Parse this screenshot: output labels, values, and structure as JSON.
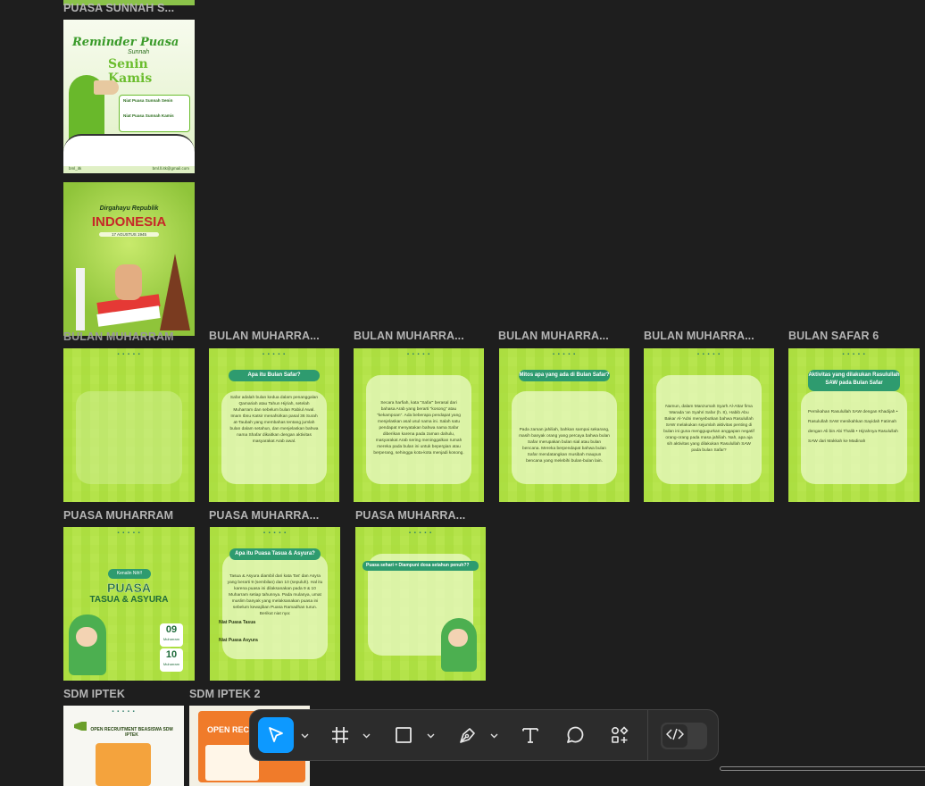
{
  "frames": {
    "top_label": "PUASA SUNNAH S...",
    "reminder": {
      "title_line1": "Reminder Puasa",
      "title_line2": "Sunnah",
      "title_line3": "Senin Kamis",
      "niat1": "Niat Puasa Sunnah Senin",
      "niat2": "Niat Puasa Sunnah Kamis",
      "footer_handle": "bml_itk",
      "footer_email": "bml.ll.itk@gmail.com"
    },
    "dirgahayu": {
      "line1": "Dirgahayu Republik",
      "line2": "INDONESIA",
      "line3": "17 AGUSTUS 1945"
    },
    "row1_labels": [
      "BULAN MUHARRAM",
      "BULAN MUHARRA...",
      "BULAN MUHARRA...",
      "BULAN MUHARRA...",
      "BULAN MUHARRA...",
      "BULAN SAFAR 6"
    ],
    "row1_titles": [
      "",
      "Apa itu Bulan Safar?",
      "",
      "Mitos apa yang ada di Bulan Safar?",
      "",
      "Aktivitas yang dilakukan Rasulullah SAW pada Bulan Safar"
    ],
    "row1_bodies": [
      "",
      "Safar adalah bulan kedua dalam penanggalan Qamariah atau Tahun Hijriah, setelah Muharram dan sebelum bulan Rabiul Awal. Imam Ibnu Katsir menafsirkan pasal 36 Surah at-Taubah yang membahas tentang jumlah bulan dalam setahun, dan menjelaskan bahwa nama Shafar dikaitkan dengan aktivitas masyarakat Arab awal.",
      "Secara harfiah, kata \"Safar\" berasal dari bahasa Arab yang berarti \"kosong\" atau \"kekampoan\". Ada beberapa pendapat yang menjelaskan asal usul nama ini. Salah satu pendapat menyatakan bahwa nama Safar diberikan karena pada zaman dahulu, masyarakat Arab sering meninggalkan rumah mereka pada bulan ini untuk bepergian atau berperang, sehingga kota-kota menjadi kosong.",
      "Pada zaman jahiliah, bahkan sampai sekarang, masih banyak orang yang percaya bahwa bulan Safar merupakan bulan sial atau bulan bencana. Mereka berpendapat bahwa bulan Safar mendatangkan musibah maupun bencana yang melebihi bulan-bulan lain.",
      "Namun, dalam Manzumah Syarh Al-Attar fima Warada 'an Syahri Safar (h. 8), Habib Abu Bakar Al-'Adni menyebutkan bahwa Rasulullah SAW melakukan sejumlah aktivitas penting di bulan ini guna menggugurkan anggapan negatif orang-orang pada masa jahiliah. Nah, apa aja sih aktivitas yang dilakukan Rasulullah SAW pada bulan Safar?",
      "Pernikahan Rasulullah SAW dengan Khadijah • Rasulullah SAW menikahkan Sayidah Fatimah dengan Ali bin Abi Thalib • Hijrahnya Rasulullah SAW dari Makkah ke Madinah"
    ],
    "row2_labels": [
      "PUASA MUHARRAM",
      "PUASA MUHARRA...",
      "PUASA MUHARRA..."
    ],
    "puasa1": {
      "badge": "Kenalin Nih!!",
      "title1": "PUASA",
      "title2": "TASUA & ASYURA",
      "date1_num": "09",
      "date1_month": "Muharram",
      "date2_num": "10",
      "date2_month": "Muharram"
    },
    "puasa2": {
      "title": "Apa itu Puasa Tasua & Asyura?",
      "body": "Tasua & Asyura diambil dari kata Tas' dan Asyra yang berarti 9 (sembilan) dan 10 (sepuluh). Hal itu karena puasa ini dilaksanakan pada 9 & 10 Muharram setiap tahunnya. Pada mulanya, umat muslim banyak yang melaksanakan puasa ini sebelum kewajiban Puasa Ramadhan turun. Berikut niat nya:",
      "niat1": "Niat Puasa Tasua",
      "niat2": "Niat Puasa Asyura"
    },
    "puasa3": {
      "title": "Puasa sehari = Diampuni dosa setahun penuh??"
    },
    "row3_labels": [
      "SDM IPTEK",
      "SDM IPTEK 2"
    ],
    "sdm1": {
      "title": "OPEN RECRUITMENT BEASISWA SDM IPTEK"
    },
    "sdm2": {
      "title": "OPEN REC"
    }
  },
  "toolbar": {
    "tools": [
      {
        "icon": "move-pointer-icon",
        "active": true
      },
      {
        "icon": "frame-icon",
        "active": false
      },
      {
        "icon": "rectangle-icon",
        "active": false
      },
      {
        "icon": "pen-icon",
        "active": false
      },
      {
        "icon": "text-icon",
        "active": false
      },
      {
        "icon": "comment-icon",
        "active": false
      },
      {
        "icon": "actions-icon",
        "active": false
      }
    ],
    "dev_mode_icon": "code-icon"
  },
  "colors": {
    "canvas": "#1e1e1e",
    "accent": "#0d99ff",
    "frame_green": "#b4e34a",
    "toolbar": "#2c2c2c"
  }
}
